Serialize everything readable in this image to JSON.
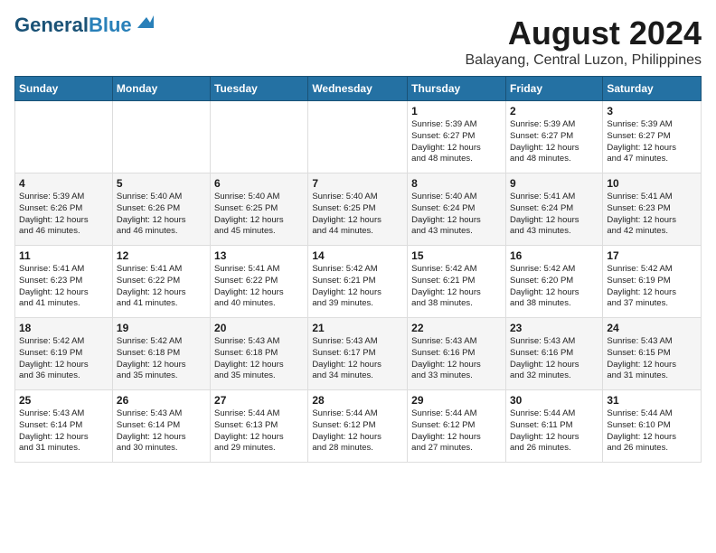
{
  "logo": {
    "line1": "General",
    "line2": "Blue"
  },
  "title": "August 2024",
  "location": "Balayang, Central Luzon, Philippines",
  "days_of_week": [
    "Sunday",
    "Monday",
    "Tuesday",
    "Wednesday",
    "Thursday",
    "Friday",
    "Saturday"
  ],
  "weeks": [
    [
      {
        "day": "",
        "info": ""
      },
      {
        "day": "",
        "info": ""
      },
      {
        "day": "",
        "info": ""
      },
      {
        "day": "",
        "info": ""
      },
      {
        "day": "1",
        "info": "Sunrise: 5:39 AM\nSunset: 6:27 PM\nDaylight: 12 hours\nand 48 minutes."
      },
      {
        "day": "2",
        "info": "Sunrise: 5:39 AM\nSunset: 6:27 PM\nDaylight: 12 hours\nand 48 minutes."
      },
      {
        "day": "3",
        "info": "Sunrise: 5:39 AM\nSunset: 6:27 PM\nDaylight: 12 hours\nand 47 minutes."
      }
    ],
    [
      {
        "day": "4",
        "info": "Sunrise: 5:39 AM\nSunset: 6:26 PM\nDaylight: 12 hours\nand 46 minutes."
      },
      {
        "day": "5",
        "info": "Sunrise: 5:40 AM\nSunset: 6:26 PM\nDaylight: 12 hours\nand 46 minutes."
      },
      {
        "day": "6",
        "info": "Sunrise: 5:40 AM\nSunset: 6:25 PM\nDaylight: 12 hours\nand 45 minutes."
      },
      {
        "day": "7",
        "info": "Sunrise: 5:40 AM\nSunset: 6:25 PM\nDaylight: 12 hours\nand 44 minutes."
      },
      {
        "day": "8",
        "info": "Sunrise: 5:40 AM\nSunset: 6:24 PM\nDaylight: 12 hours\nand 43 minutes."
      },
      {
        "day": "9",
        "info": "Sunrise: 5:41 AM\nSunset: 6:24 PM\nDaylight: 12 hours\nand 43 minutes."
      },
      {
        "day": "10",
        "info": "Sunrise: 5:41 AM\nSunset: 6:23 PM\nDaylight: 12 hours\nand 42 minutes."
      }
    ],
    [
      {
        "day": "11",
        "info": "Sunrise: 5:41 AM\nSunset: 6:23 PM\nDaylight: 12 hours\nand 41 minutes."
      },
      {
        "day": "12",
        "info": "Sunrise: 5:41 AM\nSunset: 6:22 PM\nDaylight: 12 hours\nand 41 minutes."
      },
      {
        "day": "13",
        "info": "Sunrise: 5:41 AM\nSunset: 6:22 PM\nDaylight: 12 hours\nand 40 minutes."
      },
      {
        "day": "14",
        "info": "Sunrise: 5:42 AM\nSunset: 6:21 PM\nDaylight: 12 hours\nand 39 minutes."
      },
      {
        "day": "15",
        "info": "Sunrise: 5:42 AM\nSunset: 6:21 PM\nDaylight: 12 hours\nand 38 minutes."
      },
      {
        "day": "16",
        "info": "Sunrise: 5:42 AM\nSunset: 6:20 PM\nDaylight: 12 hours\nand 38 minutes."
      },
      {
        "day": "17",
        "info": "Sunrise: 5:42 AM\nSunset: 6:19 PM\nDaylight: 12 hours\nand 37 minutes."
      }
    ],
    [
      {
        "day": "18",
        "info": "Sunrise: 5:42 AM\nSunset: 6:19 PM\nDaylight: 12 hours\nand 36 minutes."
      },
      {
        "day": "19",
        "info": "Sunrise: 5:42 AM\nSunset: 6:18 PM\nDaylight: 12 hours\nand 35 minutes."
      },
      {
        "day": "20",
        "info": "Sunrise: 5:43 AM\nSunset: 6:18 PM\nDaylight: 12 hours\nand 35 minutes."
      },
      {
        "day": "21",
        "info": "Sunrise: 5:43 AM\nSunset: 6:17 PM\nDaylight: 12 hours\nand 34 minutes."
      },
      {
        "day": "22",
        "info": "Sunrise: 5:43 AM\nSunset: 6:16 PM\nDaylight: 12 hours\nand 33 minutes."
      },
      {
        "day": "23",
        "info": "Sunrise: 5:43 AM\nSunset: 6:16 PM\nDaylight: 12 hours\nand 32 minutes."
      },
      {
        "day": "24",
        "info": "Sunrise: 5:43 AM\nSunset: 6:15 PM\nDaylight: 12 hours\nand 31 minutes."
      }
    ],
    [
      {
        "day": "25",
        "info": "Sunrise: 5:43 AM\nSunset: 6:14 PM\nDaylight: 12 hours\nand 31 minutes."
      },
      {
        "day": "26",
        "info": "Sunrise: 5:43 AM\nSunset: 6:14 PM\nDaylight: 12 hours\nand 30 minutes."
      },
      {
        "day": "27",
        "info": "Sunrise: 5:44 AM\nSunset: 6:13 PM\nDaylight: 12 hours\nand 29 minutes."
      },
      {
        "day": "28",
        "info": "Sunrise: 5:44 AM\nSunset: 6:12 PM\nDaylight: 12 hours\nand 28 minutes."
      },
      {
        "day": "29",
        "info": "Sunrise: 5:44 AM\nSunset: 6:12 PM\nDaylight: 12 hours\nand 27 minutes."
      },
      {
        "day": "30",
        "info": "Sunrise: 5:44 AM\nSunset: 6:11 PM\nDaylight: 12 hours\nand 26 minutes."
      },
      {
        "day": "31",
        "info": "Sunrise: 5:44 AM\nSunset: 6:10 PM\nDaylight: 12 hours\nand 26 minutes."
      }
    ]
  ]
}
